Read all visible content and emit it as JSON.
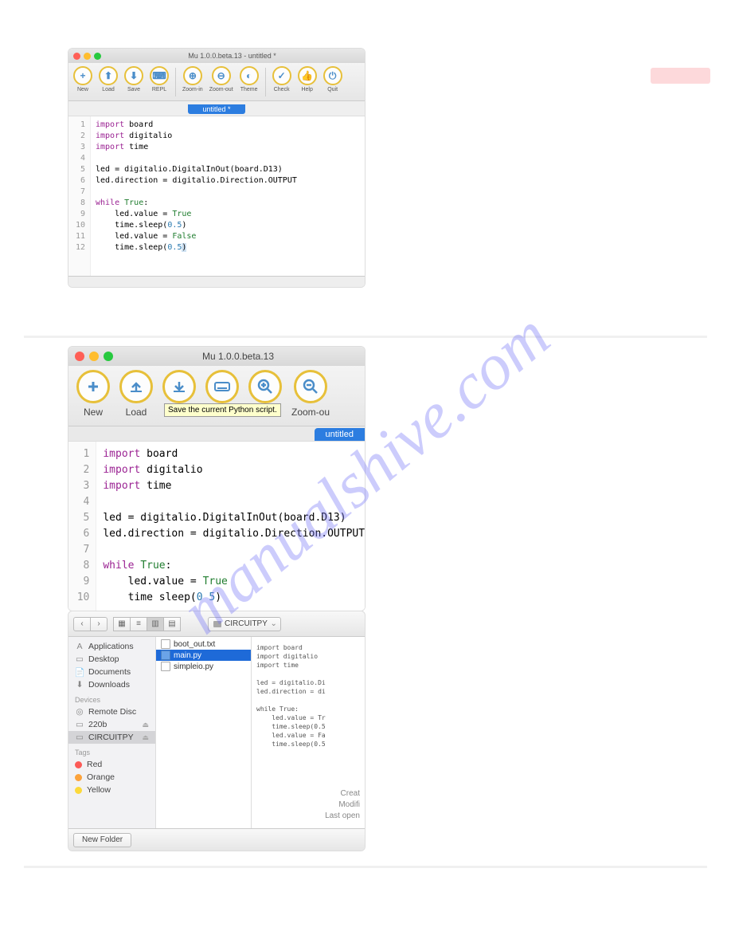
{
  "watermark": "manualshive.com",
  "screenshot1": {
    "title": "Mu 1.0.0.beta.13 - untitled *",
    "toolbar": [
      {
        "label": "New",
        "glyph": "+"
      },
      {
        "label": "Load",
        "glyph": "⬆"
      },
      {
        "label": "Save",
        "glyph": "⬇"
      },
      {
        "label": "REPL",
        "glyph": "⌨"
      },
      {
        "sep": true
      },
      {
        "label": "Zoom-in",
        "glyph": "⊕"
      },
      {
        "label": "Zoom-out",
        "glyph": "⊖"
      },
      {
        "label": "Theme",
        "glyph": "◐"
      },
      {
        "sep": true
      },
      {
        "label": "Check",
        "glyph": "✓"
      },
      {
        "label": "Help",
        "glyph": "👍"
      },
      {
        "label": "Quit",
        "glyph": "⏻"
      }
    ],
    "tab": "untitled *",
    "lines": [
      "1",
      "2",
      "3",
      "4",
      "5",
      "6",
      "7",
      "8",
      "9",
      "10",
      "11",
      "12"
    ],
    "code": [
      [
        [
          "kw",
          "import"
        ],
        [
          "",
          " board"
        ]
      ],
      [
        [
          "kw",
          "import"
        ],
        [
          "",
          " digitalio"
        ]
      ],
      [
        [
          "kw",
          "import"
        ],
        [
          "",
          " time"
        ]
      ],
      [
        [
          " ",
          ""
        ]
      ],
      [
        [
          "",
          "led "
        ],
        [
          "",
          "= digitalio.DigitalInOut(board.D13)"
        ]
      ],
      [
        [
          "",
          "led.direction "
        ],
        [
          "",
          "= digitalio.Direction.OUTPUT"
        ]
      ],
      [
        [
          " ",
          ""
        ]
      ],
      [
        [
          "kw",
          "while"
        ],
        [
          "",
          " "
        ],
        [
          "val",
          "True"
        ],
        [
          "",
          ":"
        ]
      ],
      [
        [
          "",
          "    led.value "
        ],
        [
          "",
          "= "
        ],
        [
          "val",
          "True"
        ]
      ],
      [
        [
          "",
          "    time.sleep("
        ],
        [
          "num",
          "0.5"
        ],
        [
          "",
          ")"
        ]
      ],
      [
        [
          "",
          "    led.value "
        ],
        [
          "",
          "= "
        ],
        [
          "val",
          "False"
        ]
      ],
      [
        [
          "",
          "    time.sleep("
        ],
        [
          "num",
          "0.5"
        ],
        [
          "cursor",
          ")"
        ]
      ]
    ]
  },
  "screenshot2": {
    "title": "Mu 1.0.0.beta.13",
    "toolbar": [
      {
        "label": "New",
        "icon": "plus"
      },
      {
        "label": "Load",
        "icon": "up"
      },
      {
        "label": "S",
        "icon": "down",
        "tooltip": "Save the current Python script."
      },
      {
        "label": "",
        "icon": "kb"
      },
      {
        "label": "-in",
        "icon": "zin"
      },
      {
        "label": "Zoom-ou",
        "icon": "zout"
      }
    ],
    "tab": "untitled",
    "lines": [
      "1",
      "2",
      "3",
      "4",
      "5",
      "6",
      "7",
      "8",
      "9",
      "10"
    ],
    "code": [
      [
        [
          "kw",
          "import"
        ],
        [
          "",
          " board"
        ]
      ],
      [
        [
          "kw",
          "import"
        ],
        [
          "",
          " digitalio"
        ]
      ],
      [
        [
          "kw",
          "import"
        ],
        [
          "",
          " time"
        ]
      ],
      [
        [
          " ",
          ""
        ]
      ],
      [
        [
          "",
          "led = digitalio.DigitalInOut(board.D13)"
        ]
      ],
      [
        [
          "",
          "led.direction = digitalio.Direction.OUTPUT"
        ]
      ],
      [
        [
          " ",
          ""
        ]
      ],
      [
        [
          "kw",
          "while"
        ],
        [
          "",
          " "
        ],
        [
          "val",
          "True"
        ],
        [
          "",
          ":"
        ]
      ],
      [
        [
          "",
          "    led.value = "
        ],
        [
          "val",
          "True"
        ]
      ],
      [
        [
          "",
          "    time sleep("
        ],
        [
          "num",
          "0 5"
        ],
        [
          "",
          ")"
        ]
      ]
    ]
  },
  "finder": {
    "location": "CIRCUITPY",
    "favorites": [
      {
        "label": "Applications",
        "icon": "A"
      },
      {
        "label": "Desktop",
        "icon": "▭"
      },
      {
        "label": "Documents",
        "icon": "📄"
      },
      {
        "label": "Downloads",
        "icon": "⬇"
      }
    ],
    "devicesHeader": "Devices",
    "devices": [
      {
        "label": "Remote Disc",
        "icon": "◎",
        "eject": false
      },
      {
        "label": "220b",
        "icon": "▭",
        "eject": true
      },
      {
        "label": "CIRCUITPY",
        "icon": "▭",
        "eject": true,
        "selected": true
      }
    ],
    "tagsHeader": "Tags",
    "tags": [
      {
        "label": "Red",
        "color": "#fc5b57"
      },
      {
        "label": "Orange",
        "color": "#fca33b"
      },
      {
        "label": "Yellow",
        "color": "#fcd93b"
      }
    ],
    "files": [
      {
        "label": "boot_out.txt"
      },
      {
        "label": "main.py",
        "selected": true
      },
      {
        "label": "simpleio.py"
      }
    ],
    "preview": "import board\nimport digitalio\nimport time\n\nled = digitalio.Di\nled.direction = di\n\nwhile True:\n    led.value = Tr\n    time.sleep(0.5\n    led.value = Fa\n    time.sleep(0.5",
    "metaLabels": {
      "created": "Creat",
      "modified": "Modifi",
      "lastopen": "Last open"
    },
    "newFolder": "New Folder"
  }
}
